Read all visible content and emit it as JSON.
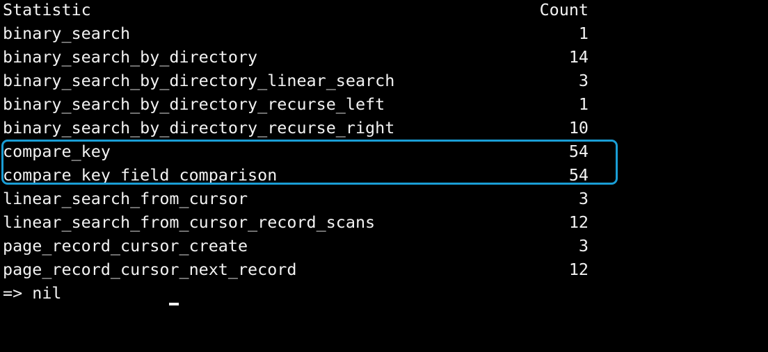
{
  "table": {
    "header": {
      "statistic": "Statistic",
      "count": "Count"
    },
    "rows": [
      {
        "statistic": "binary_search",
        "count": "1"
      },
      {
        "statistic": "binary_search_by_directory",
        "count": "14"
      },
      {
        "statistic": "binary_search_by_directory_linear_search",
        "count": "3"
      },
      {
        "statistic": "binary_search_by_directory_recurse_left",
        "count": "1"
      },
      {
        "statistic": "binary_search_by_directory_recurse_right",
        "count": "10"
      },
      {
        "statistic": "compare_key",
        "count": "54"
      },
      {
        "statistic": "compare_key_field_comparison",
        "count": "54"
      },
      {
        "statistic": "linear_search_from_cursor",
        "count": "3"
      },
      {
        "statistic": "linear_search_from_cursor_record_scans",
        "count": "12"
      },
      {
        "statistic": "page_record_cursor_create",
        "count": "3"
      },
      {
        "statistic": "page_record_cursor_next_record",
        "count": "12"
      }
    ]
  },
  "result_line": "=> nil",
  "colors": {
    "background": "#000000",
    "text": "#f2f2f2",
    "highlight": "#1a9ed6"
  }
}
